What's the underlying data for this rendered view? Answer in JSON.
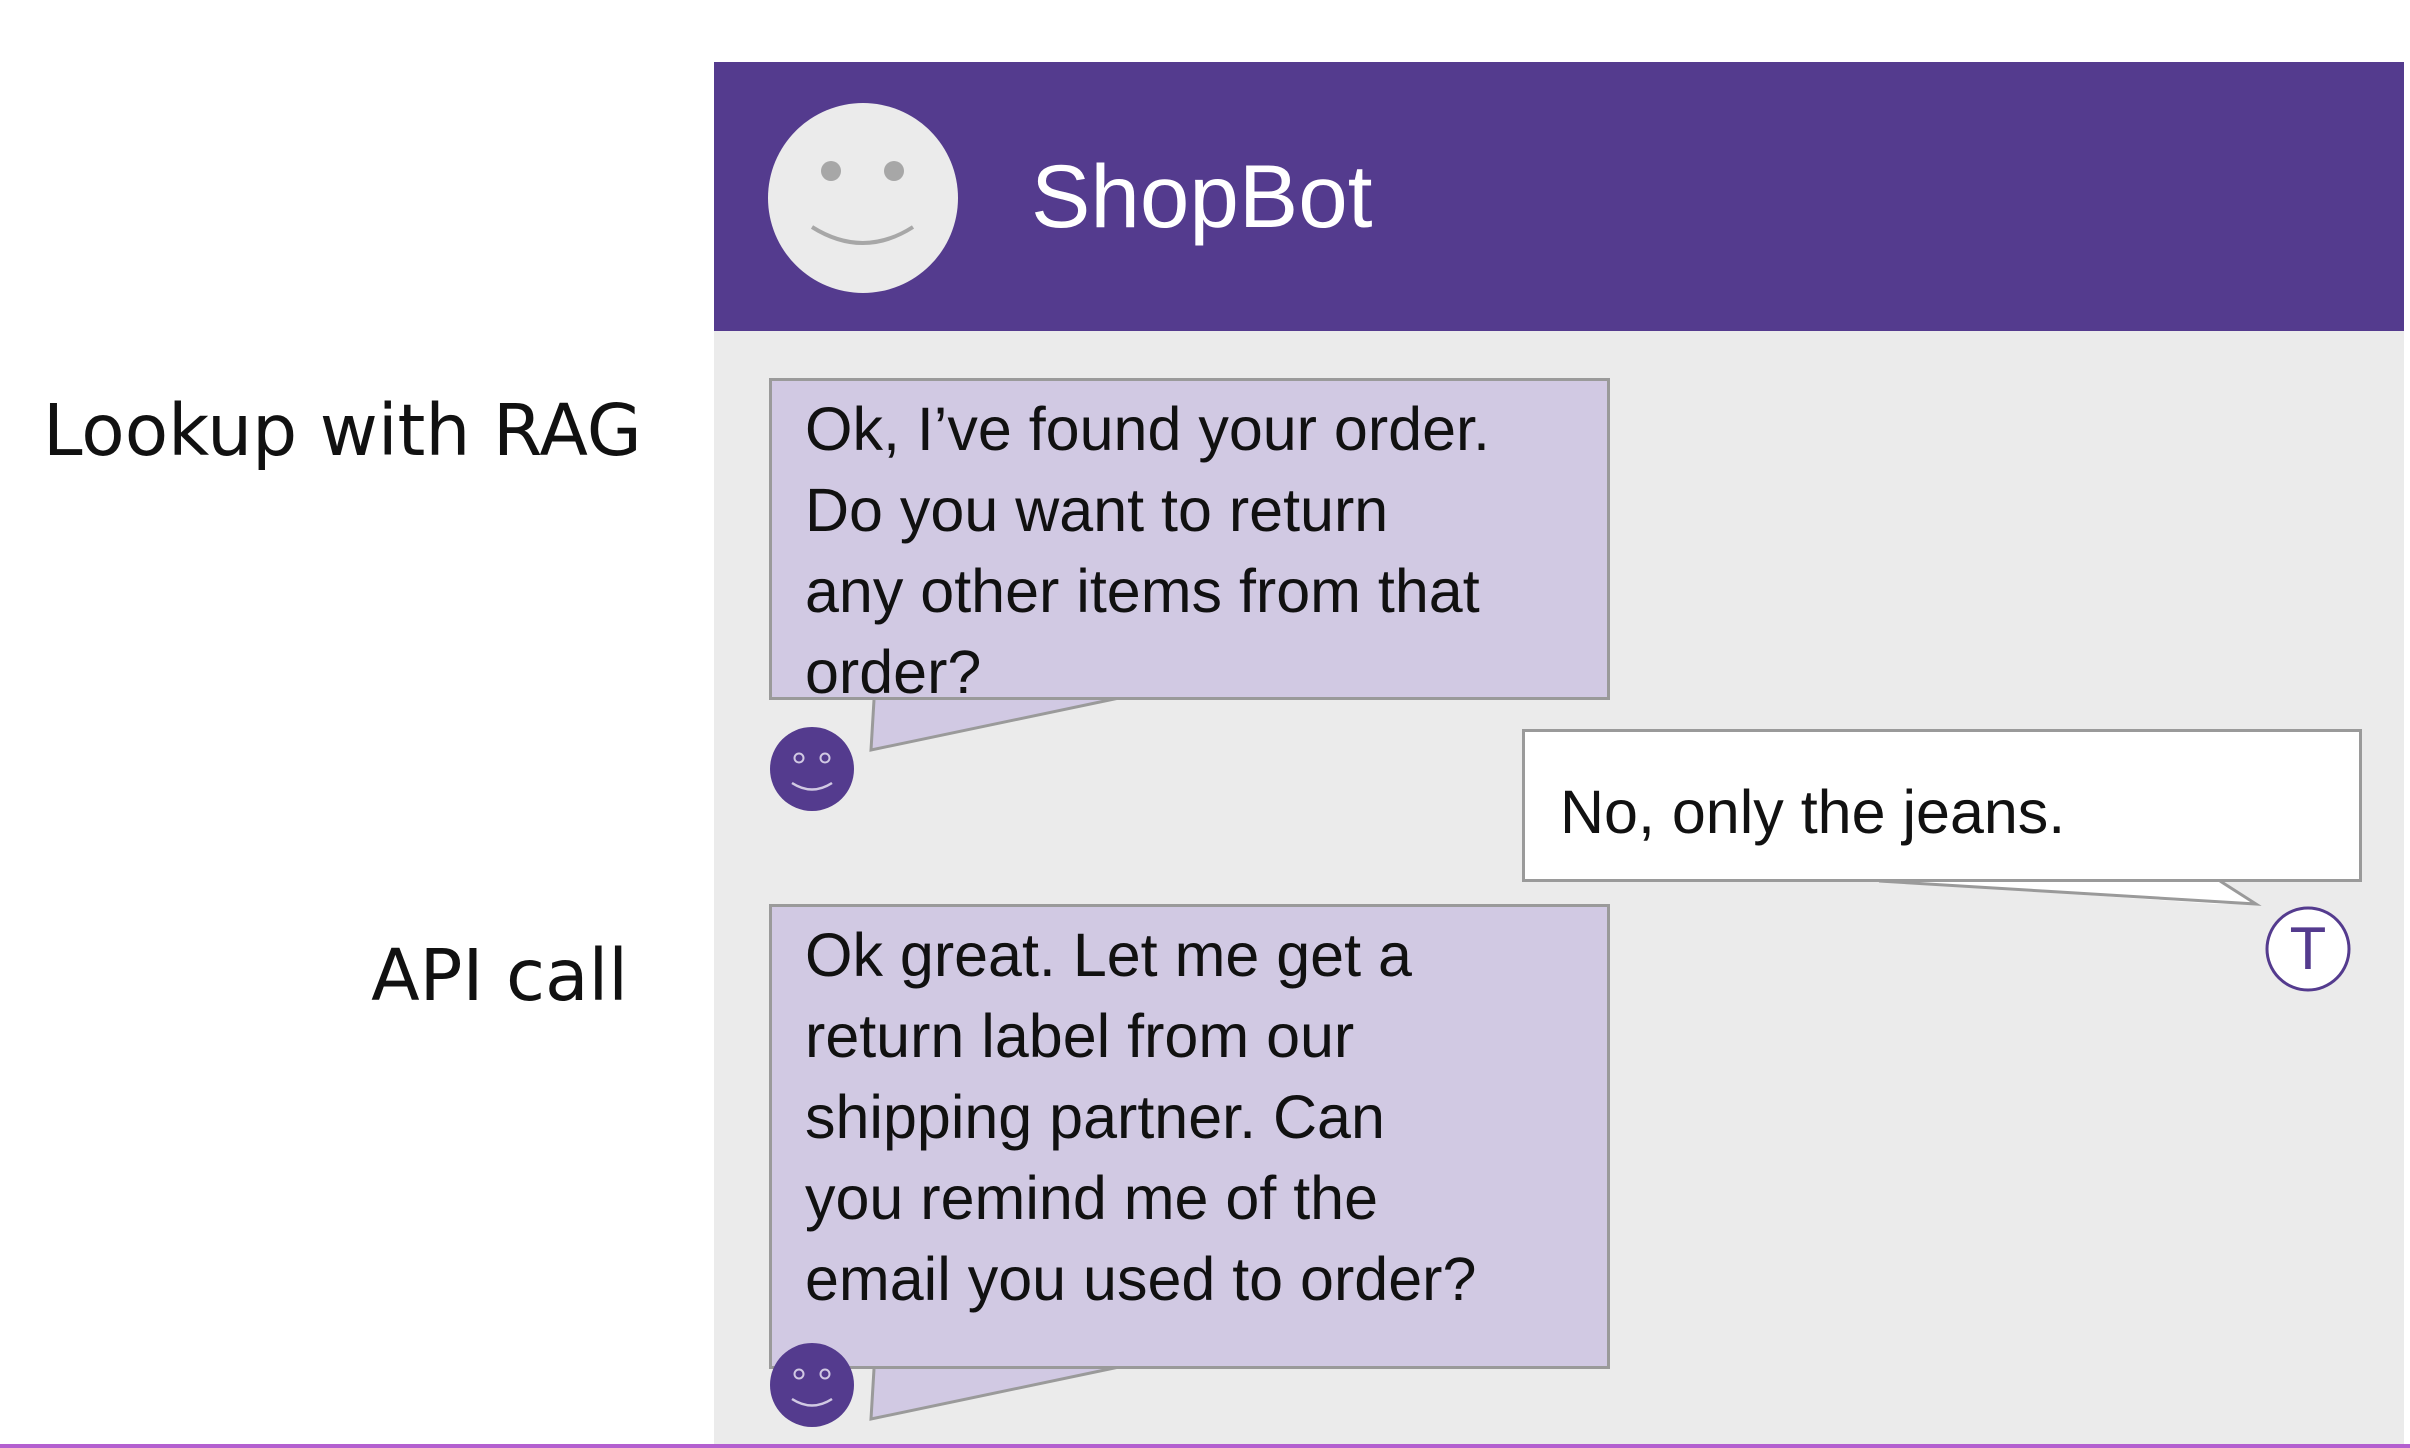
{
  "annotations": {
    "lookup_label": "Lookup with RAG",
    "api_label": "API call"
  },
  "chat": {
    "title": "ShopBot",
    "header_color": "#543b8e",
    "bot_bubble_color": "#d1c9e3",
    "bot_avatar_icon": "smiley-face-icon",
    "messages": [
      {
        "sender": "bot",
        "text": "Ok, I’ve found your order.\nDo you want to return\nany other items from that\norder?"
      },
      {
        "sender": "user",
        "avatar_letter": "T",
        "text": "No, only the jeans."
      },
      {
        "sender": "bot",
        "text": "Ok great. Let me get a\nreturn label from our\nshipping partner.  Can\nyou remind me of the\nemail you used to order?"
      }
    ]
  }
}
